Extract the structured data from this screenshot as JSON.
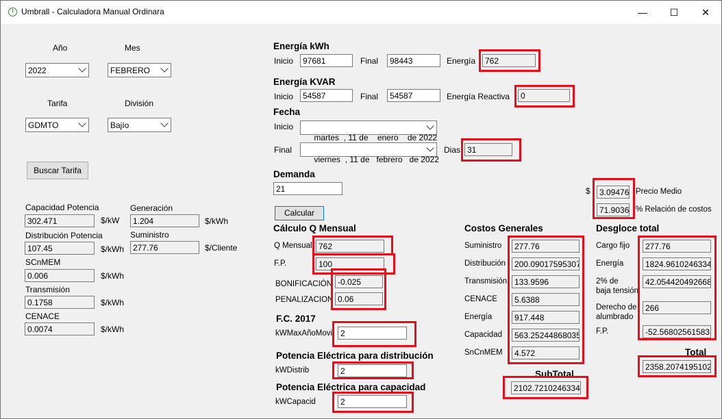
{
  "window": {
    "title": "Umbrall - Calculadora Manual Ordinara",
    "minimize": "—",
    "maximize": "☐",
    "close": "✕"
  },
  "left": {
    "ano_label": "Año",
    "mes_label": "Mes",
    "ano_value": "2022",
    "mes_value": "FEBRERO",
    "tarifa_label": "Tarifa",
    "division_label": "División",
    "tarifa_value": "GDMTO",
    "division_value": "Bajío",
    "buscar_label": "Buscar Tarifa",
    "cap_pot_label": "Capacidad Potencia",
    "cap_pot_value": "302.471",
    "cap_pot_unit": "$/kW",
    "generacion_label": "Generación",
    "generacion_value": "1.204",
    "generacion_unit": "$/kWh",
    "dist_pot_label": "Distribución Potencia",
    "dist_pot_value": "107.45",
    "dist_pot_unit": "$/kWh",
    "suministro_label": "Suministro",
    "suministro_value": "277.76",
    "suministro_unit": "$/Cliente",
    "scnmem_label": "SCnMEM",
    "scnmem_value": "0.006",
    "scnmem_unit": "$/kWh",
    "transmision_label": "Transmisión",
    "transmision_value": "0.1758",
    "transmision_unit": "$/kWh",
    "cenace_label": "CENACE",
    "cenace_value": "0.0074",
    "cenace_unit": "$/kWh"
  },
  "energia_kwh": {
    "header": "Energía kWh",
    "inicio_label": "Inicio",
    "inicio_value": "97681",
    "final_label": "Final",
    "final_value": "98443",
    "energia_label": "Energía",
    "energia_value": "762"
  },
  "energia_kvar": {
    "header": "Energía KVAR",
    "inicio_label": "Inicio",
    "inicio_value": "54587",
    "final_label": "Final",
    "final_value": "54587",
    "reactiva_label": "Energía Reactiva",
    "reactiva_value": "0"
  },
  "fecha": {
    "header": "Fecha",
    "inicio_label": "Inicio",
    "inicio_value": "martes  , 11 de    enero    de 2022",
    "final_label": "Final",
    "final_value": "viernes  , 11 de   febrero   de 2022",
    "dias_label": "Dias",
    "dias_value": "31"
  },
  "demanda": {
    "header": "Demanda",
    "value": "21",
    "calcular_label": "Calcular"
  },
  "precio": {
    "currency": "$",
    "precio_medio_value": "3.094760",
    "precio_medio_label": "Precio Medio",
    "relacion_value": "71.90367",
    "relacion_label": "% Relación de costos"
  },
  "q_mensual": {
    "header": "Cálculo Q Mensual",
    "q_label": "Q Mensual",
    "q_value": "762",
    "fp_label": "F.P.",
    "fp_value": "100",
    "bonif_label": "BONIFICACIÓN",
    "bonif_value": "-0.025",
    "penal_label": "PENALIZACION",
    "penal_value": "0.06"
  },
  "fc": {
    "header": "F.C. 2017",
    "label": "kWMaxAñoMovil",
    "value": "2"
  },
  "pot_dist": {
    "header": "Potencia Eléctrica para distribución",
    "label": "kWDistrib",
    "value": "2"
  },
  "pot_cap": {
    "header": "Potencia Eléctrica para capacidad",
    "label": "kWCapacid",
    "value": "2"
  },
  "costos": {
    "header": "Costos Generales",
    "items": [
      {
        "label": "Suministro",
        "value": "277.76"
      },
      {
        "label": "Distribución",
        "value": "200.090175953079"
      },
      {
        "label": "Transmisión",
        "value": "133.9596"
      },
      {
        "label": "CENACE",
        "value": "5.6388"
      },
      {
        "label": "Energía",
        "value": "917.448"
      },
      {
        "label": "Capacidad",
        "value": "563.252448680352"
      },
      {
        "label": "SnCnMEM",
        "value": "4.572"
      }
    ],
    "subtotal_label": "SubTotal",
    "subtotal_value": "2102.72102463343"
  },
  "desglose": {
    "header": "Desgloce total",
    "cargo_label": "Cargo fijo",
    "cargo_value": "277.76",
    "energia_label": "Energía",
    "energia_value": "1824.96102463343",
    "baja1_label": "2% de",
    "baja2_label": "baja tensión",
    "baja_value": "42.0544204926686",
    "derecho1_label": "Derecho de",
    "derecho2_label": "alumbrado",
    "derecho_value": "266",
    "fp_label": "F.P.",
    "fp_value": "-52.5680256158358",
    "total_label": "Total",
    "total_value": "2358.20741951026"
  },
  "accent": {
    "highlight": "#e3101b",
    "window_bg": "#f0f0f0"
  }
}
